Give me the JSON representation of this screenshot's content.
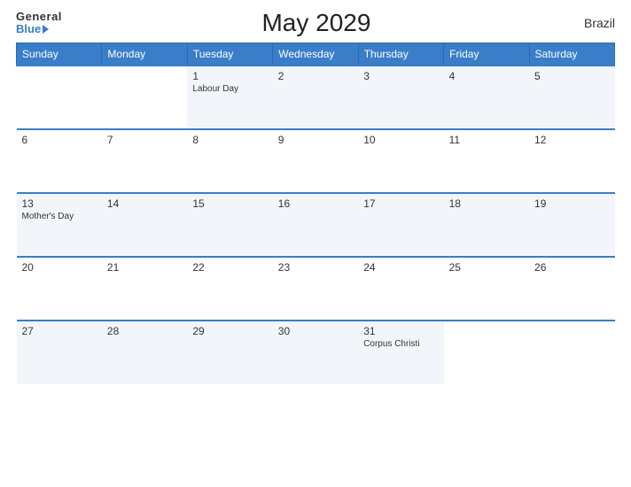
{
  "header": {
    "logo_general": "General",
    "logo_blue": "Blue",
    "title": "May 2029",
    "country": "Brazil"
  },
  "weekdays": [
    "Sunday",
    "Monday",
    "Tuesday",
    "Wednesday",
    "Thursday",
    "Friday",
    "Saturday"
  ],
  "weeks": [
    [
      {
        "day": "",
        "holiday": ""
      },
      {
        "day": "",
        "holiday": ""
      },
      {
        "day": "1",
        "holiday": "Labour Day"
      },
      {
        "day": "2",
        "holiday": ""
      },
      {
        "day": "3",
        "holiday": ""
      },
      {
        "day": "4",
        "holiday": ""
      },
      {
        "day": "5",
        "holiday": ""
      }
    ],
    [
      {
        "day": "6",
        "holiday": ""
      },
      {
        "day": "7",
        "holiday": ""
      },
      {
        "day": "8",
        "holiday": ""
      },
      {
        "day": "9",
        "holiday": ""
      },
      {
        "day": "10",
        "holiday": ""
      },
      {
        "day": "11",
        "holiday": ""
      },
      {
        "day": "12",
        "holiday": ""
      }
    ],
    [
      {
        "day": "13",
        "holiday": "Mother's Day"
      },
      {
        "day": "14",
        "holiday": ""
      },
      {
        "day": "15",
        "holiday": ""
      },
      {
        "day": "16",
        "holiday": ""
      },
      {
        "day": "17",
        "holiday": ""
      },
      {
        "day": "18",
        "holiday": ""
      },
      {
        "day": "19",
        "holiday": ""
      }
    ],
    [
      {
        "day": "20",
        "holiday": ""
      },
      {
        "day": "21",
        "holiday": ""
      },
      {
        "day": "22",
        "holiday": ""
      },
      {
        "day": "23",
        "holiday": ""
      },
      {
        "day": "24",
        "holiday": ""
      },
      {
        "day": "25",
        "holiday": ""
      },
      {
        "day": "26",
        "holiday": ""
      }
    ],
    [
      {
        "day": "27",
        "holiday": ""
      },
      {
        "day": "28",
        "holiday": ""
      },
      {
        "day": "29",
        "holiday": ""
      },
      {
        "day": "30",
        "holiday": ""
      },
      {
        "day": "31",
        "holiday": "Corpus Christi"
      },
      {
        "day": "",
        "holiday": ""
      },
      {
        "day": "",
        "holiday": ""
      }
    ]
  ]
}
